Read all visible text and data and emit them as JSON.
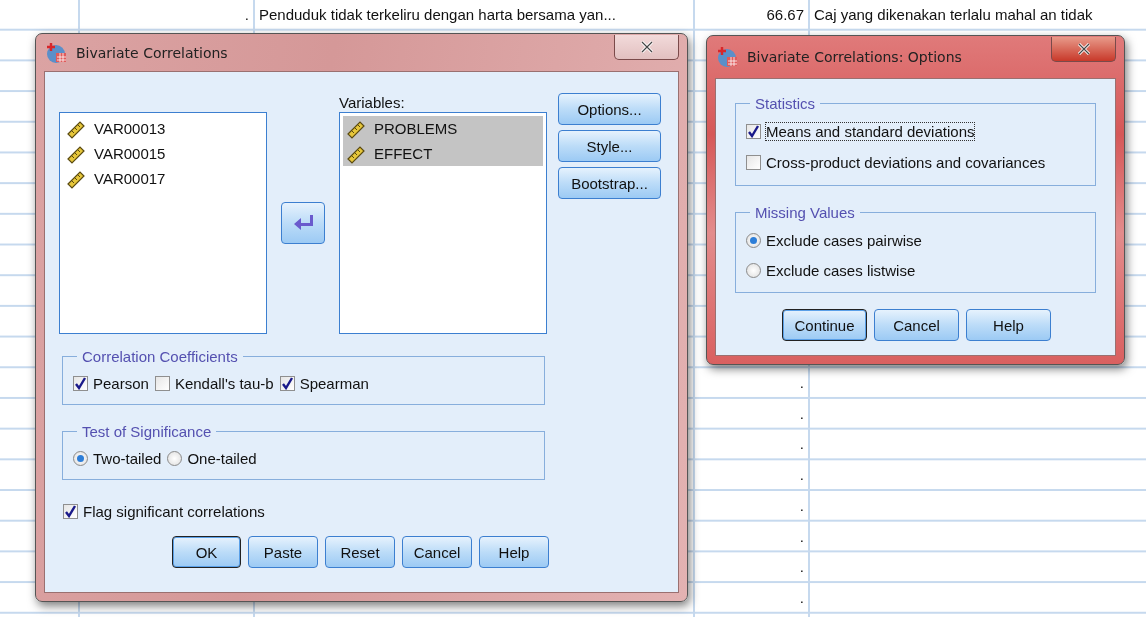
{
  "sheet": {
    "top_row": {
      "column_2": ".",
      "column_3": "Penduduk tidak terkeliru dengan harta bersama yan...",
      "column_4": "66.67",
      "column_5": "Caj yang dikenakan terlalu mahal an tidak"
    },
    "dot_rows": [
      ".",
      ".",
      ".",
      ".",
      ".",
      ".",
      ".",
      "."
    ]
  },
  "main_dialog": {
    "title": "Bivariate Correlations",
    "source_list": [
      {
        "label": "VAR00013",
        "selected": false
      },
      {
        "label": "VAR00015",
        "selected": false
      },
      {
        "label": "VAR00017",
        "selected": false
      }
    ],
    "target_list": {
      "label": "Variables:",
      "items": [
        {
          "label": "PROBLEMS",
          "selected": true
        },
        {
          "label": "EFFECT",
          "selected": true
        }
      ]
    },
    "side_buttons": [
      "Options...",
      "Style...",
      "Bootstrap..."
    ],
    "coefficients": {
      "title": "Correlation Coefficients",
      "options": [
        {
          "label": "Pearson",
          "checked": true
        },
        {
          "label": "Kendall's tau-b",
          "checked": false
        },
        {
          "label": "Spearman",
          "checked": true
        }
      ]
    },
    "significance": {
      "title": "Test of Significance",
      "options": [
        {
          "label": "Two-tailed",
          "selected": true
        },
        {
          "label": "One-tailed",
          "selected": false
        }
      ]
    },
    "flag": {
      "label": "Flag significant correlations",
      "checked": true
    },
    "buttons": [
      {
        "label": "OK",
        "default": true
      },
      {
        "label": "Paste",
        "default": false
      },
      {
        "label": "Reset",
        "default": false
      },
      {
        "label": "Cancel",
        "default": false
      },
      {
        "label": "Help",
        "default": false
      }
    ]
  },
  "options_dialog": {
    "title": "Bivariate Correlations: Options",
    "statistics": {
      "title": "Statistics",
      "options": [
        {
          "label": "Means and standard deviations",
          "checked": true,
          "focused": true
        },
        {
          "label": "Cross-product deviations and covariances",
          "checked": false,
          "focused": false
        }
      ]
    },
    "missing_values": {
      "title": "Missing Values",
      "options": [
        {
          "label": "Exclude cases pairwise",
          "selected": true
        },
        {
          "label": "Exclude cases listwise",
          "selected": false
        }
      ]
    },
    "buttons": [
      {
        "label": "Continue",
        "default": true
      },
      {
        "label": "Cancel",
        "default": false
      },
      {
        "label": "Help",
        "default": false
      }
    ]
  }
}
